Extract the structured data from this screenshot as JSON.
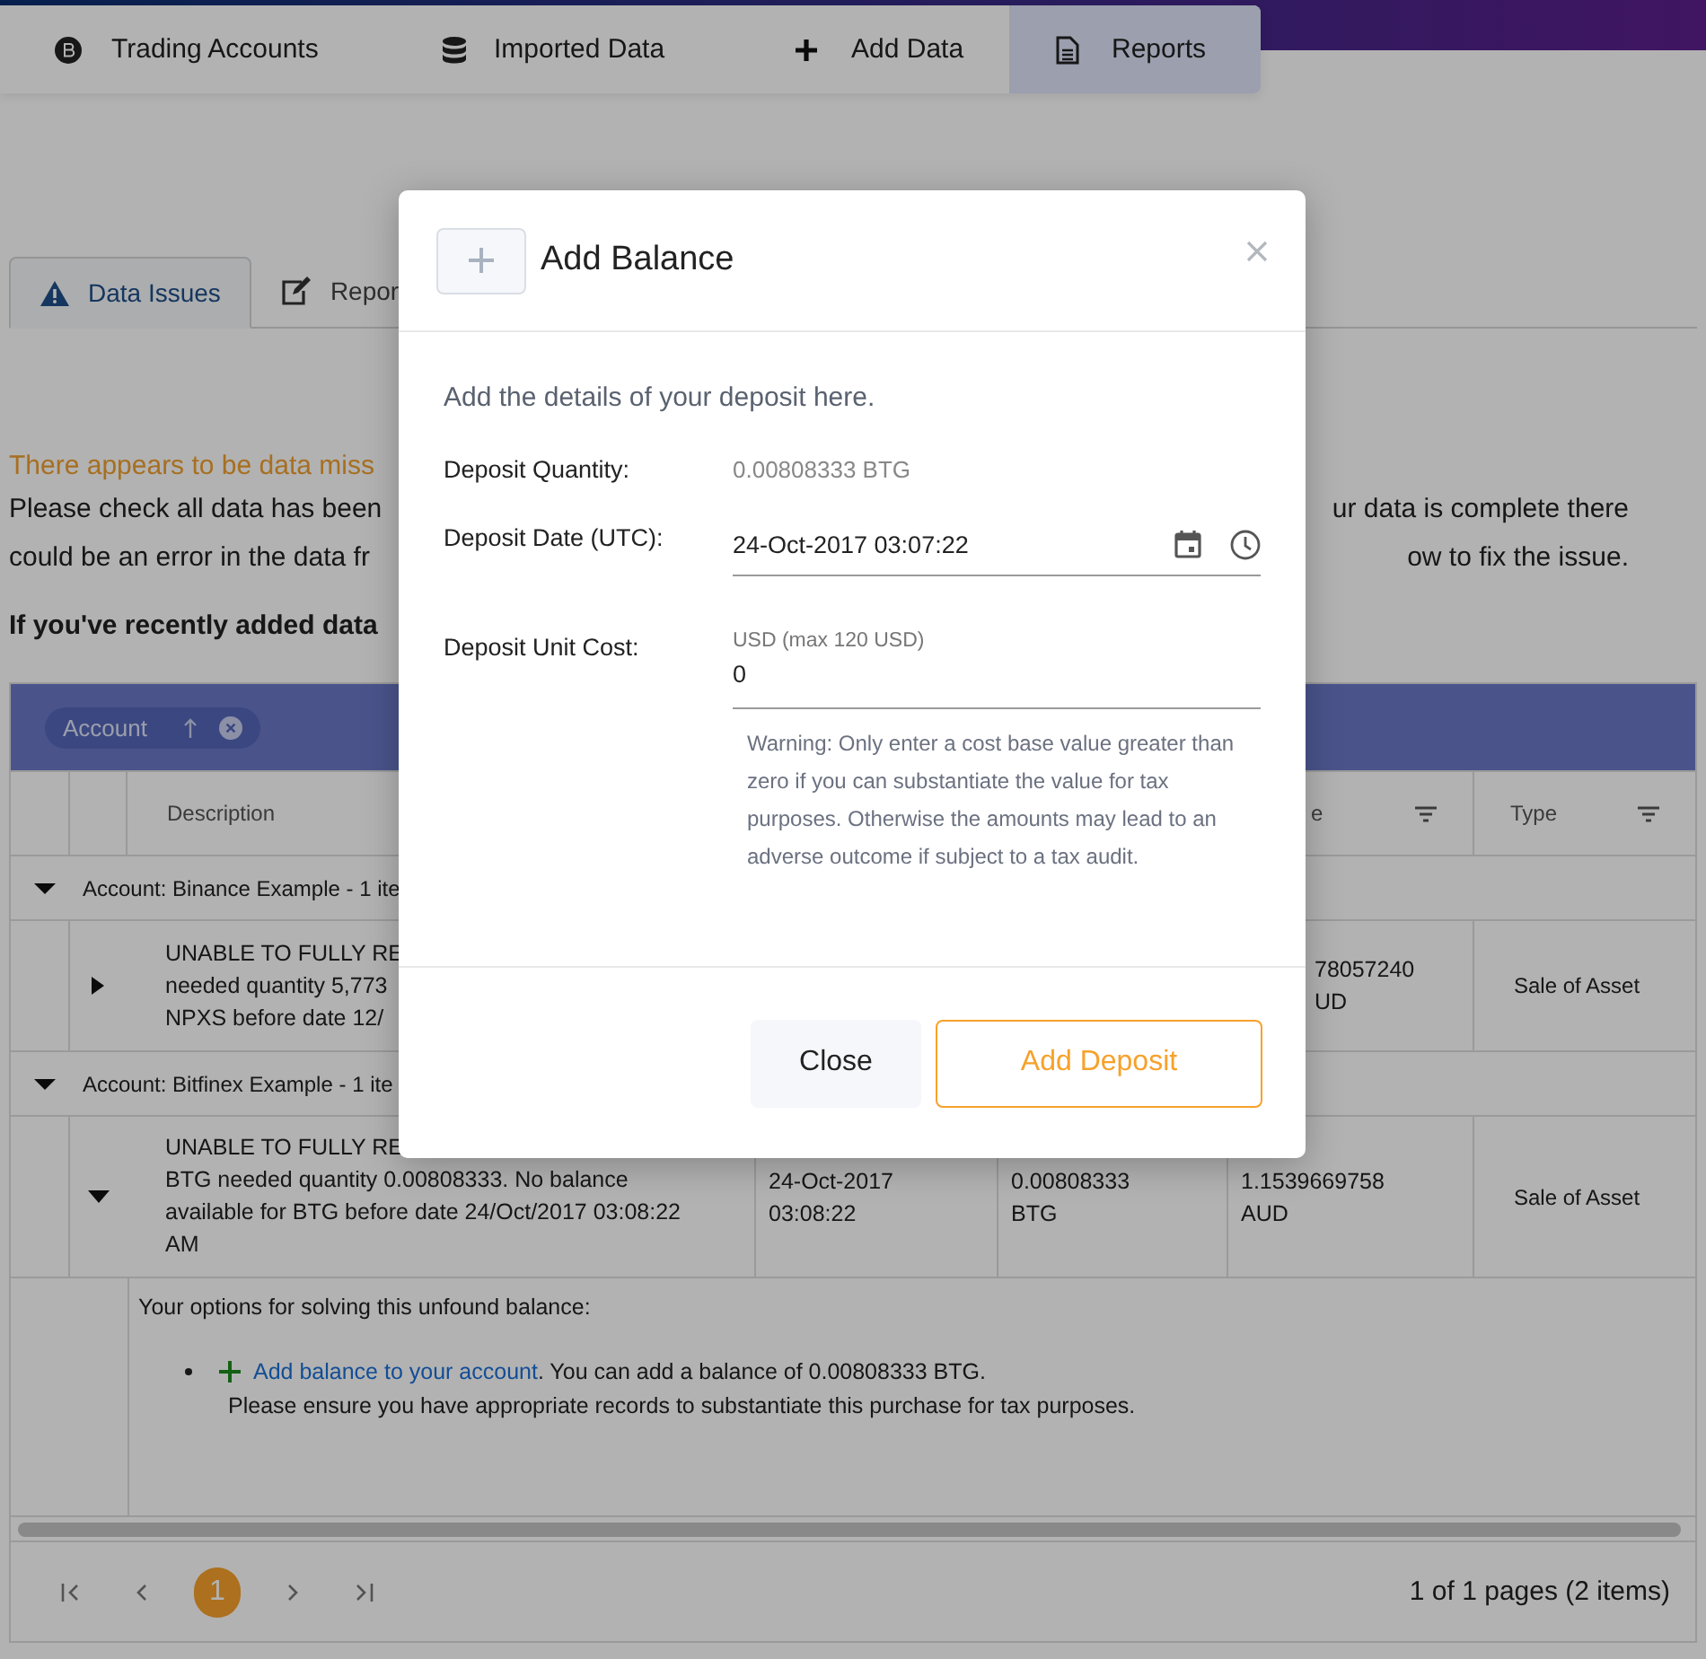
{
  "nav_tabs": [
    {
      "label": "Trading Accounts",
      "selected": false
    },
    {
      "label": "Imported Data",
      "selected": false
    },
    {
      "label": "Add Data",
      "selected": false
    },
    {
      "label": "Reports",
      "selected": true
    }
  ],
  "sub_tabs": [
    {
      "label": "Data Issues",
      "selected": true
    },
    {
      "label": "Repor",
      "selected": false
    }
  ],
  "notice": {
    "warning": "There appears to be data miss",
    "lines": [
      {
        "left": "Please check all data has been",
        "right": "ur data is complete there"
      },
      {
        "left": "could be an error in the data fr",
        "right": "ow to fix the issue."
      }
    ],
    "bold": "If you've recently added data"
  },
  "table": {
    "group_chip": {
      "label": "Account"
    },
    "columns": {
      "description": "Description",
      "column_6": "e",
      "type": "Type"
    },
    "groups": [
      {
        "title": "Account: Binance Example - 1 ite",
        "expanded": true,
        "rows": [
          {
            "expanded": false,
            "description": "UNABLE TO FULLY RE\nneeded quantity 5,773\nNPXS before date 12/",
            "value": "78057240\nUD",
            "type": "Sale of Asset"
          }
        ]
      },
      {
        "title": "Account: Bitfinex Example - 1 ite",
        "expanded": true,
        "rows": [
          {
            "expanded": true,
            "description": "UNABLE TO FULLY RE\nBTG needed quantity 0.00808333. No balance\navailable for BTG before date 24/Oct/2017 03:08:22\nAM",
            "date": "24-Oct-2017\n03:08:22",
            "quantity": "0.00808333\nBTG",
            "value": "1.1539669758\nAUD",
            "type": "Sale of Asset",
            "detail": {
              "heading": "Your options for solving this unfound balance:",
              "link": "Add balance to your account",
              "after_link": ". You can add a balance of 0.00808333 BTG.",
              "note": "Please ensure you have appropriate records to substantiate this purchase for tax purposes."
            }
          }
        ]
      }
    ],
    "pager": {
      "pages": [
        {
          "label": "1",
          "selected": true
        }
      ],
      "summary": "1 of 1 pages (2 items)"
    }
  },
  "modal": {
    "title": "Add Balance",
    "intro": "Add the details of your deposit here.",
    "fields": [
      {
        "kind": "static",
        "label": "Deposit Quantity:",
        "value": "0.00808333 BTG"
      },
      {
        "kind": "datetime",
        "label": "Deposit Date (UTC):",
        "value": "24-Oct-2017 03:07:22"
      },
      {
        "kind": "number",
        "label": "Deposit Unit Cost:",
        "float_label": "USD (max 120 USD)",
        "value": "0",
        "warning": "Warning: Only enter a cost base value greater than zero if you can substantiate the value for tax purposes. Otherwise the amounts may lead to an adverse outcome if subject to a tax audit."
      }
    ],
    "buttons": [
      {
        "kind": "secondary",
        "label": "Close"
      },
      {
        "kind": "primary",
        "label": "Add Deposit"
      }
    ]
  }
}
